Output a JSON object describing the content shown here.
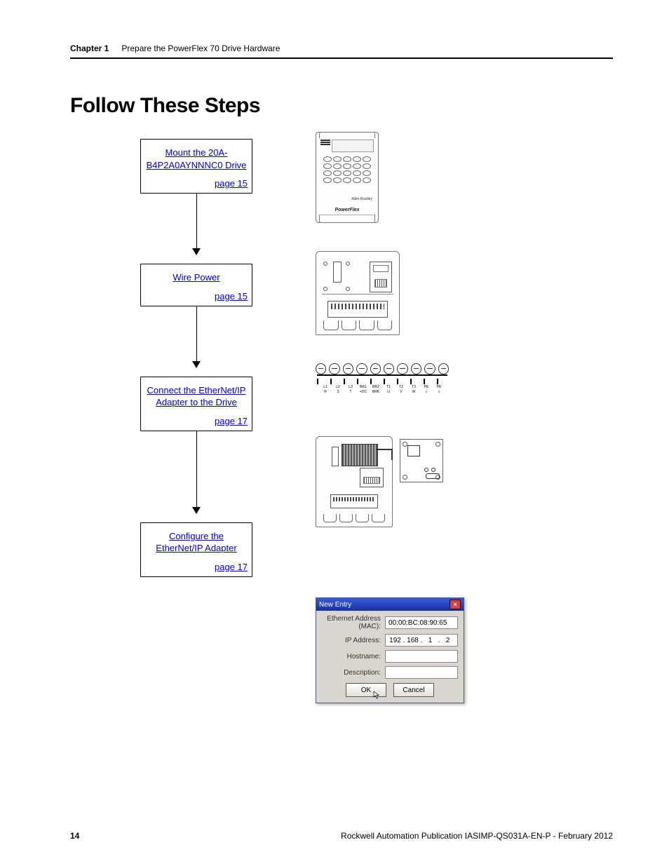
{
  "header": {
    "chapter": "Chapter 1",
    "title": "Prepare the PowerFlex 70 Drive Hardware"
  },
  "section_title": "Follow These Steps",
  "steps": [
    {
      "label": "Mount the 20A-B4P2A0AYNNNC0 Drive",
      "page_ref": "page 15"
    },
    {
      "label": "Wire Power",
      "page_ref": "page 15"
    },
    {
      "label": "Connect the EtherNet/IP Adapter to the Drive",
      "page_ref": "page 17"
    },
    {
      "label": "Configure the EtherNet/IP Adapter",
      "page_ref": "page 17"
    }
  ],
  "drive_front": {
    "brand_small": "Allen-Bradley",
    "logo": "PowerFlex"
  },
  "terminal_labels": [
    {
      "t": "L1",
      "b": "R"
    },
    {
      "t": "L2",
      "b": "S"
    },
    {
      "t": "L3",
      "b": "T"
    },
    {
      "t": "BR1",
      "b": "+DC"
    },
    {
      "t": "BR2",
      "b": "BRK"
    },
    {
      "t": "T1",
      "b": "U"
    },
    {
      "t": "T2",
      "b": "V"
    },
    {
      "t": "T3",
      "b": "W"
    },
    {
      "t": "PE",
      "b": "⏚"
    },
    {
      "t": "PE",
      "b": "⏚"
    }
  ],
  "dialog": {
    "title": "New Entry",
    "fields": {
      "mac_label": "Ethernet Address (MAC):",
      "mac_value": "00:00:BC:08:90:65",
      "ip_label": "IP Address:",
      "ip_value": [
        "192",
        "168",
        "1",
        "2"
      ],
      "hostname_label": "Hostname:",
      "hostname_value": "",
      "desc_label": "Description:",
      "desc_value": ""
    },
    "buttons": {
      "ok": "OK",
      "cancel": "Cancel"
    }
  },
  "footer": {
    "page_number": "14",
    "publication": "Rockwell Automation Publication IASIMP-QS031A-EN-P - February 2012"
  }
}
